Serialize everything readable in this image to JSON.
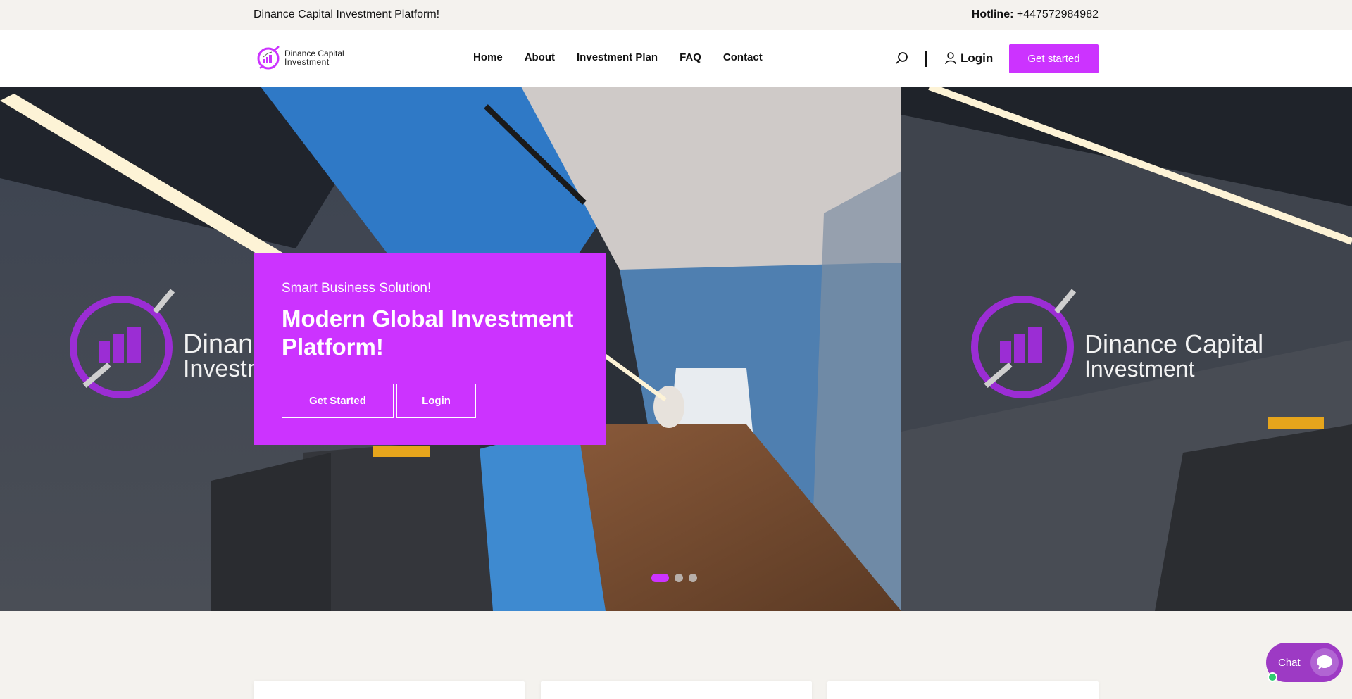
{
  "topbar": {
    "tagline": "Dinance Capital Investment Platform!",
    "hotline_label": "Hotline:",
    "hotline_number": "+447572984982"
  },
  "header": {
    "logo_line1": "Dinance Capital",
    "logo_line2": "Investment",
    "nav": [
      "Home",
      "About",
      "Investment Plan",
      "FAQ",
      "Contact"
    ],
    "login_label": "Login",
    "cta_label": "Get started"
  },
  "hero": {
    "kicker": "Smart Business Solution!",
    "headline": "Modern Global Investment Platform!",
    "primary_button": "Get Started",
    "secondary_button": "Login",
    "slides_total": 3,
    "active_slide": 1,
    "sign_line1": "Dinance Capital",
    "sign_line2": "Investment"
  },
  "chat": {
    "label": "Chat"
  },
  "colors": {
    "brand": "#cc33ff",
    "chat": "#9d3ac4",
    "online": "#2ecc71"
  },
  "icons": [
    "search-icon",
    "user-icon",
    "chat-bubble-icon",
    "logo-mark"
  ]
}
